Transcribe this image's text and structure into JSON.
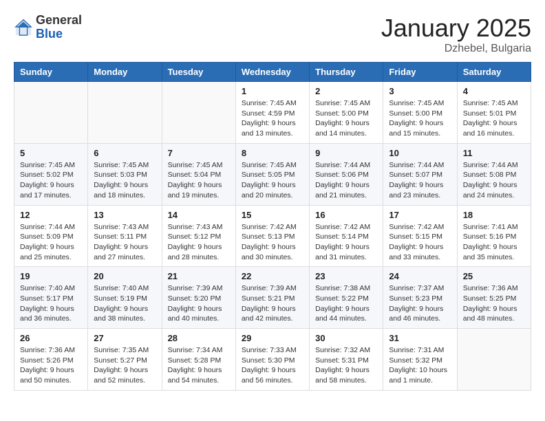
{
  "header": {
    "logo_general": "General",
    "logo_blue": "Blue",
    "month": "January 2025",
    "location": "Dzhebel, Bulgaria"
  },
  "days_of_week": [
    "Sunday",
    "Monday",
    "Tuesday",
    "Wednesday",
    "Thursday",
    "Friday",
    "Saturday"
  ],
  "weeks": [
    [
      {
        "day": "",
        "info": ""
      },
      {
        "day": "",
        "info": ""
      },
      {
        "day": "",
        "info": ""
      },
      {
        "day": "1",
        "info": "Sunrise: 7:45 AM\nSunset: 4:59 PM\nDaylight: 9 hours and 13 minutes."
      },
      {
        "day": "2",
        "info": "Sunrise: 7:45 AM\nSunset: 5:00 PM\nDaylight: 9 hours and 14 minutes."
      },
      {
        "day": "3",
        "info": "Sunrise: 7:45 AM\nSunset: 5:00 PM\nDaylight: 9 hours and 15 minutes."
      },
      {
        "day": "4",
        "info": "Sunrise: 7:45 AM\nSunset: 5:01 PM\nDaylight: 9 hours and 16 minutes."
      }
    ],
    [
      {
        "day": "5",
        "info": "Sunrise: 7:45 AM\nSunset: 5:02 PM\nDaylight: 9 hours and 17 minutes."
      },
      {
        "day": "6",
        "info": "Sunrise: 7:45 AM\nSunset: 5:03 PM\nDaylight: 9 hours and 18 minutes."
      },
      {
        "day": "7",
        "info": "Sunrise: 7:45 AM\nSunset: 5:04 PM\nDaylight: 9 hours and 19 minutes."
      },
      {
        "day": "8",
        "info": "Sunrise: 7:45 AM\nSunset: 5:05 PM\nDaylight: 9 hours and 20 minutes."
      },
      {
        "day": "9",
        "info": "Sunrise: 7:44 AM\nSunset: 5:06 PM\nDaylight: 9 hours and 21 minutes."
      },
      {
        "day": "10",
        "info": "Sunrise: 7:44 AM\nSunset: 5:07 PM\nDaylight: 9 hours and 23 minutes."
      },
      {
        "day": "11",
        "info": "Sunrise: 7:44 AM\nSunset: 5:08 PM\nDaylight: 9 hours and 24 minutes."
      }
    ],
    [
      {
        "day": "12",
        "info": "Sunrise: 7:44 AM\nSunset: 5:09 PM\nDaylight: 9 hours and 25 minutes."
      },
      {
        "day": "13",
        "info": "Sunrise: 7:43 AM\nSunset: 5:11 PM\nDaylight: 9 hours and 27 minutes."
      },
      {
        "day": "14",
        "info": "Sunrise: 7:43 AM\nSunset: 5:12 PM\nDaylight: 9 hours and 28 minutes."
      },
      {
        "day": "15",
        "info": "Sunrise: 7:42 AM\nSunset: 5:13 PM\nDaylight: 9 hours and 30 minutes."
      },
      {
        "day": "16",
        "info": "Sunrise: 7:42 AM\nSunset: 5:14 PM\nDaylight: 9 hours and 31 minutes."
      },
      {
        "day": "17",
        "info": "Sunrise: 7:42 AM\nSunset: 5:15 PM\nDaylight: 9 hours and 33 minutes."
      },
      {
        "day": "18",
        "info": "Sunrise: 7:41 AM\nSunset: 5:16 PM\nDaylight: 9 hours and 35 minutes."
      }
    ],
    [
      {
        "day": "19",
        "info": "Sunrise: 7:40 AM\nSunset: 5:17 PM\nDaylight: 9 hours and 36 minutes."
      },
      {
        "day": "20",
        "info": "Sunrise: 7:40 AM\nSunset: 5:19 PM\nDaylight: 9 hours and 38 minutes."
      },
      {
        "day": "21",
        "info": "Sunrise: 7:39 AM\nSunset: 5:20 PM\nDaylight: 9 hours and 40 minutes."
      },
      {
        "day": "22",
        "info": "Sunrise: 7:39 AM\nSunset: 5:21 PM\nDaylight: 9 hours and 42 minutes."
      },
      {
        "day": "23",
        "info": "Sunrise: 7:38 AM\nSunset: 5:22 PM\nDaylight: 9 hours and 44 minutes."
      },
      {
        "day": "24",
        "info": "Sunrise: 7:37 AM\nSunset: 5:23 PM\nDaylight: 9 hours and 46 minutes."
      },
      {
        "day": "25",
        "info": "Sunrise: 7:36 AM\nSunset: 5:25 PM\nDaylight: 9 hours and 48 minutes."
      }
    ],
    [
      {
        "day": "26",
        "info": "Sunrise: 7:36 AM\nSunset: 5:26 PM\nDaylight: 9 hours and 50 minutes."
      },
      {
        "day": "27",
        "info": "Sunrise: 7:35 AM\nSunset: 5:27 PM\nDaylight: 9 hours and 52 minutes."
      },
      {
        "day": "28",
        "info": "Sunrise: 7:34 AM\nSunset: 5:28 PM\nDaylight: 9 hours and 54 minutes."
      },
      {
        "day": "29",
        "info": "Sunrise: 7:33 AM\nSunset: 5:30 PM\nDaylight: 9 hours and 56 minutes."
      },
      {
        "day": "30",
        "info": "Sunrise: 7:32 AM\nSunset: 5:31 PM\nDaylight: 9 hours and 58 minutes."
      },
      {
        "day": "31",
        "info": "Sunrise: 7:31 AM\nSunset: 5:32 PM\nDaylight: 10 hours and 1 minute."
      },
      {
        "day": "",
        "info": ""
      }
    ]
  ]
}
